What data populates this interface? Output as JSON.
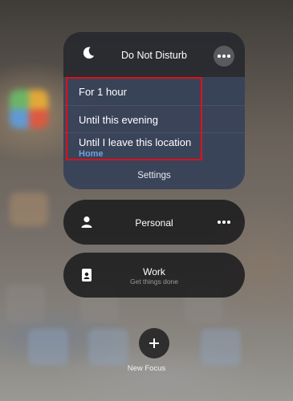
{
  "dnd": {
    "title": "Do Not Disturb",
    "icon": "moon-icon",
    "options": [
      {
        "label": "For 1 hour"
      },
      {
        "label": "Until this evening"
      },
      {
        "label": "Until I leave this location",
        "sublabel": "Home"
      }
    ],
    "settings_label": "Settings"
  },
  "focus_modes": [
    {
      "label": "Personal",
      "icon": "person-icon"
    },
    {
      "label": "Work",
      "sublabel": "Get things done",
      "icon": "id-badge-icon"
    }
  ],
  "new_focus": {
    "label": "New Focus"
  },
  "colors": {
    "highlight": "#e0101a",
    "sublabel_accent": "#6ea3dd"
  }
}
